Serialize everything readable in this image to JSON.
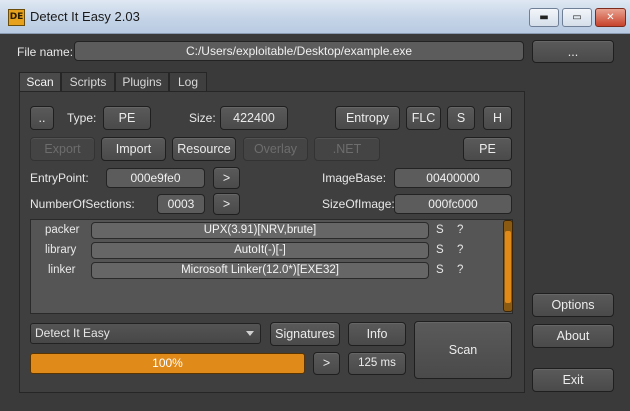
{
  "window": {
    "title": "Detect It Easy 2.03",
    "icon_text": "DE",
    "min_glyph": "▬",
    "max_glyph": "▭",
    "close_glyph": "✕"
  },
  "file": {
    "label": "File name:",
    "path": "C:/Users/exploitable/Desktop/example.exe",
    "browse_label": "..."
  },
  "tabs": [
    {
      "label": "Scan",
      "active": true
    },
    {
      "label": "Scripts",
      "active": false
    },
    {
      "label": "Plugins",
      "active": false
    },
    {
      "label": "Log",
      "active": false
    }
  ],
  "scan": {
    "dots_label": "..",
    "type_label": "Type:",
    "type_value": "PE",
    "size_label": "Size:",
    "size_value": "422400",
    "entropy_label": "Entropy",
    "flc_label": "FLC",
    "s_label": "S",
    "h_label": "H",
    "export_label": "Export",
    "import_label": "Import",
    "resource_label": "Resource",
    "overlay_label": "Overlay",
    "net_label": ".NET",
    "pe_label": "PE",
    "entrypoint_label": "EntryPoint:",
    "entrypoint_value": "000e9fe0",
    "entrypoint_go": ">",
    "imagebase_label": "ImageBase:",
    "imagebase_value": "00400000",
    "sections_label": "NumberOfSections:",
    "sections_value": "0003",
    "sections_go": ">",
    "sizeofimage_label": "SizeOfImage:",
    "sizeofimage_value": "000fc000"
  },
  "results": [
    {
      "name": "packer",
      "value": "UPX(3.91)[NRV,brute]",
      "s": "S",
      "q": "?"
    },
    {
      "name": "library",
      "value": "AutoIt(-)[-]",
      "s": "S",
      "q": "?"
    },
    {
      "name": "linker",
      "value": "Microsoft Linker(12.0*)[EXE32]",
      "s": "S",
      "q": "?"
    }
  ],
  "bottom": {
    "database": "Detect It Easy",
    "signatures_label": "Signatures",
    "info_label": "Info",
    "scan_label": "Scan",
    "progress_percent": 100,
    "progress_text": "100%",
    "next_label": ">",
    "time_label": "125 ms"
  },
  "side": {
    "options_label": "Options",
    "about_label": "About",
    "exit_label": "Exit"
  },
  "colors": {
    "accent": "#e08a1a",
    "background": "#3a3a3a"
  }
}
